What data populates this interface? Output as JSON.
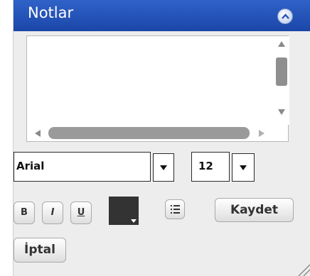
{
  "header": {
    "title": "Notlar",
    "collapse_icon": "chevron-up-icon"
  },
  "notes": {
    "value": "",
    "scroll_up_icon": "triangle-up-icon",
    "scroll_down_icon": "triangle-down-icon",
    "scroll_left_icon": "triangle-left-icon",
    "scroll_right_icon": "triangle-right-icon"
  },
  "toolbar": {
    "font_family": "Arial",
    "font_size": "12",
    "bold_label": "B",
    "italic_label": "I",
    "underline_label": "U",
    "text_color": "#333333",
    "list_icon": "bulleted-list-icon"
  },
  "actions": {
    "save_label": "Kaydet",
    "cancel_label": "İptal"
  },
  "colors": {
    "header_bg": "#2453b8",
    "panel_bg": "#ededed"
  }
}
